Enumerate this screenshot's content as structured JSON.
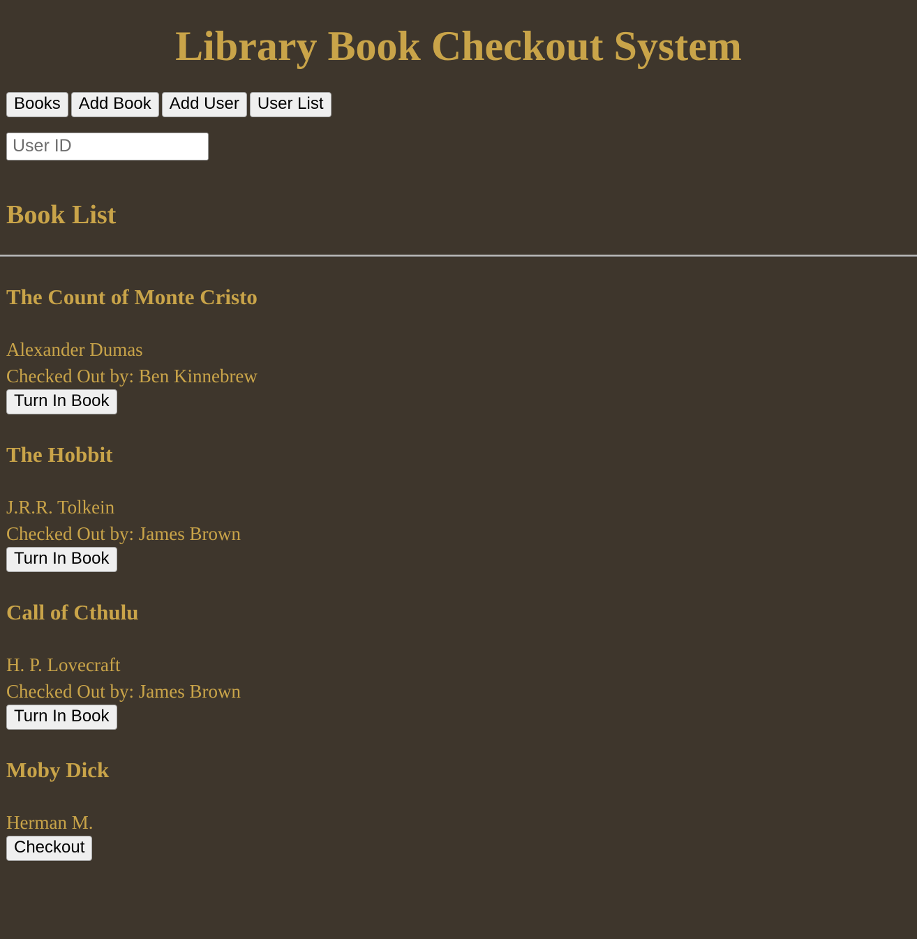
{
  "app": {
    "title": "Library Book Checkout System",
    "background_color": "#3E362C",
    "accent_color": "#C9A449",
    "button_background_color": "#EFEFEF"
  },
  "nav": {
    "items": [
      {
        "label": "Books"
      },
      {
        "label": "Add Book"
      },
      {
        "label": "Add User"
      },
      {
        "label": "User List"
      }
    ]
  },
  "user_id_field": {
    "placeholder": "User ID",
    "value": ""
  },
  "section": {
    "heading": "Book List"
  },
  "books": [
    {
      "title": "The Count of Monte Cristo",
      "author": "Alexander Dumas",
      "checked_out_line": "Checked Out by: Ben Kinnebrew",
      "action_label": "Turn In Book"
    },
    {
      "title": "The Hobbit",
      "author": "J.R.R. Tolkein",
      "checked_out_line": "Checked Out by: James Brown",
      "action_label": "Turn In Book"
    },
    {
      "title": "Call of Cthulu",
      "author": "H. P. Lovecraft",
      "checked_out_line": "Checked Out by: James Brown",
      "action_label": "Turn In Book"
    },
    {
      "title": "Moby Dick",
      "author": "Herman M.",
      "checked_out_line": "",
      "action_label": "Checkout"
    }
  ]
}
